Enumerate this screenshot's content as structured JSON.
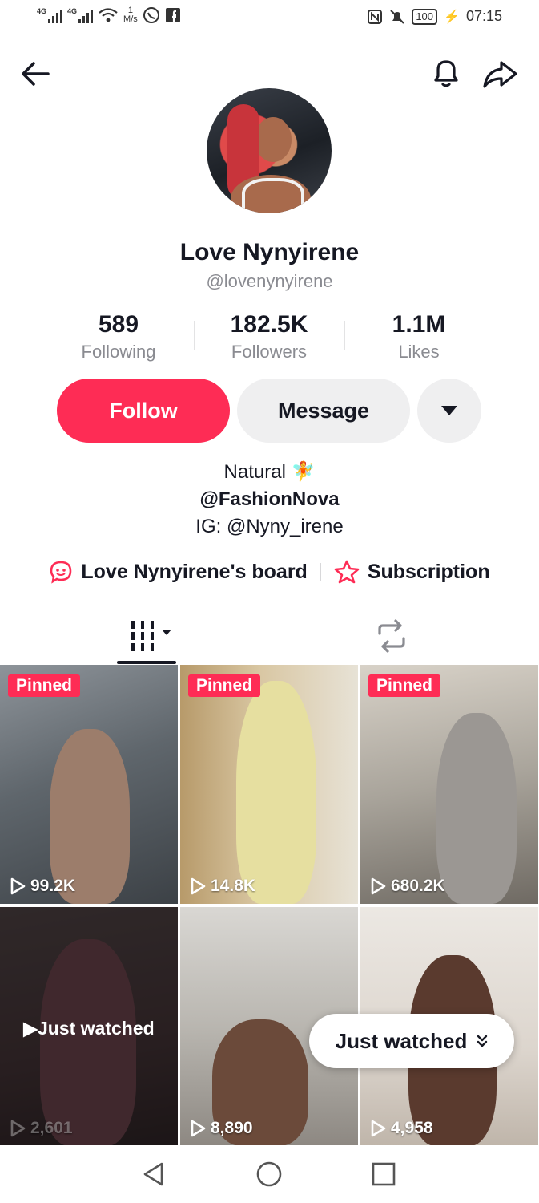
{
  "status_bar": {
    "net1": "4G",
    "net2": "4G",
    "speed_value": "1",
    "speed_unit": "M/s",
    "battery": "100",
    "time": "07:15"
  },
  "profile": {
    "name": "Love Nynyirene",
    "handle": "@lovenynyirene"
  },
  "stats": [
    {
      "value": "589",
      "label": "Following"
    },
    {
      "value": "182.5K",
      "label": "Followers"
    },
    {
      "value": "1.1M",
      "label": "Likes"
    }
  ],
  "actions": {
    "follow": "Follow",
    "message": "Message"
  },
  "bio": {
    "line1": "Natural 🧚",
    "line2": "@FashionNova",
    "line3": "IG: @Nyny_irene"
  },
  "links": {
    "board": "Love Nynyirene's board",
    "subscription": "Subscription"
  },
  "videos": [
    {
      "pinned": "Pinned",
      "views": "99.2K"
    },
    {
      "pinned": "Pinned",
      "views": "14.8K"
    },
    {
      "pinned": "Pinned",
      "views": "680.2K"
    },
    {
      "overlay": "Just watched",
      "views": "2,601"
    },
    {
      "views": "8,890"
    },
    {
      "views": "4,958"
    }
  ],
  "just_watched_pill": "Just watched",
  "colors": {
    "accent": "#fe2c55",
    "text": "#161823",
    "muted": "#8a8b91",
    "button_bg": "#efeff0"
  }
}
